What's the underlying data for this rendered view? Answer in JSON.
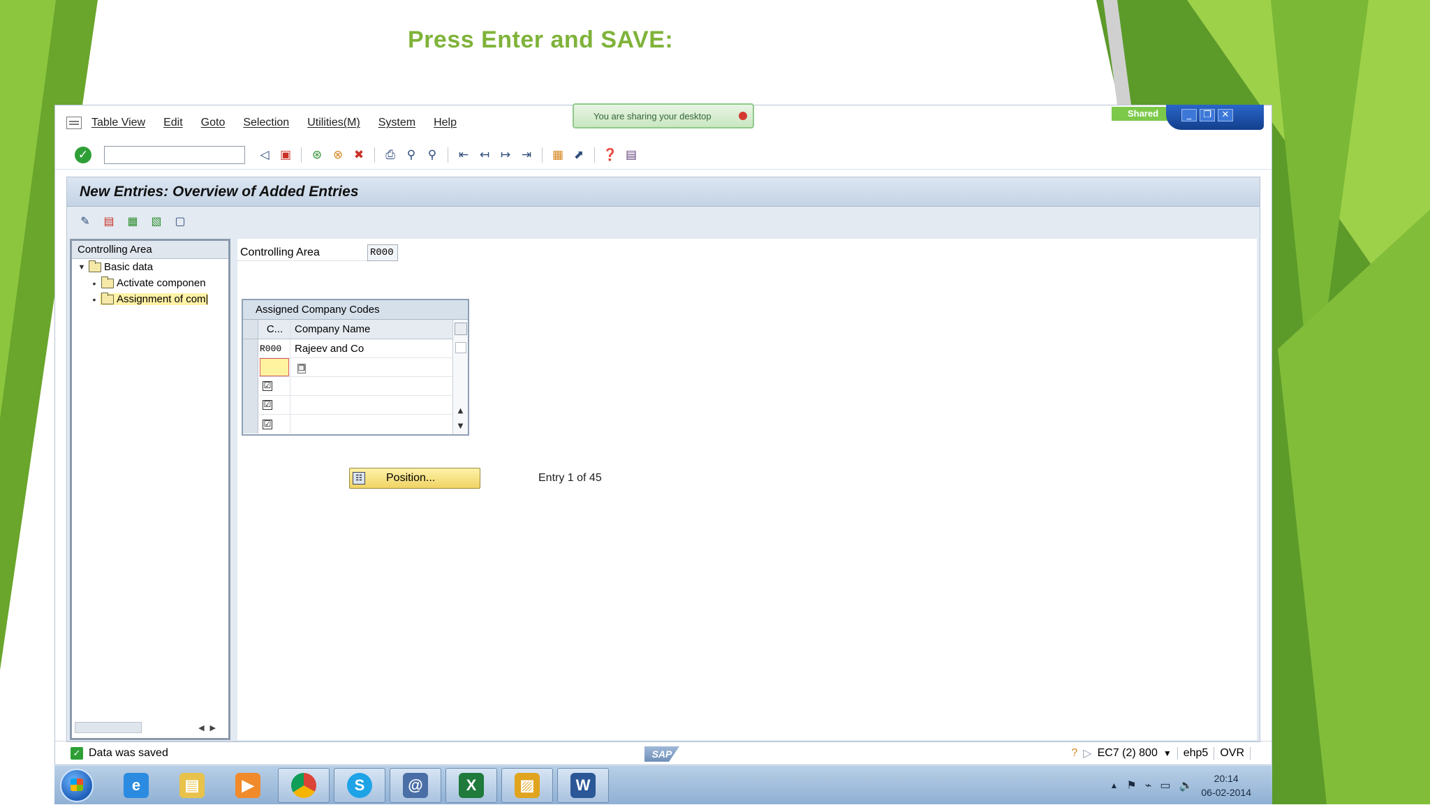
{
  "slide": {
    "title": "Press Enter and SAVE:"
  },
  "sharing": {
    "banner": "You are sharing your desktop",
    "tag": "Shared"
  },
  "menubar": {
    "items": [
      "Table View",
      "Edit",
      "Goto",
      "Selection",
      "Utilities(M)",
      "System",
      "Help"
    ]
  },
  "toolbar": {
    "command_field_value": "",
    "icons": [
      "enter-icon",
      "back-nav-icon",
      "save-icon",
      "back-icon",
      "exit-icon",
      "cancel-icon",
      "print-icon",
      "find-icon",
      "find-next-icon",
      "first-page-icon",
      "previous-page-icon",
      "next-page-icon",
      "last-page-icon",
      "create-session-icon",
      "shortcut-icon",
      "help-icon",
      "customize-layout-icon"
    ]
  },
  "page": {
    "title": "New Entries: Overview of Added Entries"
  },
  "nav": {
    "header": "Controlling Area",
    "items": [
      {
        "label": "Basic data",
        "level": 0,
        "expanded": true
      },
      {
        "label": "Activate componen",
        "level": 1
      },
      {
        "label": "Assignment of com|",
        "level": 1,
        "selected": true
      }
    ]
  },
  "form": {
    "controlling_area_label": "Controlling Area",
    "controlling_area_value": "R000"
  },
  "table": {
    "title": "Assigned Company Codes",
    "columns": [
      "C...",
      "Company Name"
    ],
    "rows": [
      {
        "code": "R000",
        "name": "Rajeev and Co"
      },
      {
        "code": "",
        "name": ""
      },
      {
        "code": "☑",
        "name": ""
      },
      {
        "code": "☑",
        "name": ""
      },
      {
        "code": "☑",
        "name": ""
      }
    ]
  },
  "position_button": "Position...",
  "entry_info": "Entry 1 of 45",
  "status": {
    "message": "Data was saved",
    "logo": "SAP",
    "system": "EC7 (2) 800",
    "server": "ehp5",
    "mode": "OVR"
  },
  "taskbar": {
    "apps": [
      "internet-explorer",
      "file-explorer",
      "media-player",
      "chrome",
      "skype",
      "sap-logon",
      "excel",
      "sticky-folder",
      "word"
    ],
    "time": "20:14",
    "date": "06-02-2014"
  },
  "colors": {
    "title_green": "#7fb33a",
    "sap_blue": "#c4d3e5",
    "highlight_yellow": "#fff3a0"
  }
}
